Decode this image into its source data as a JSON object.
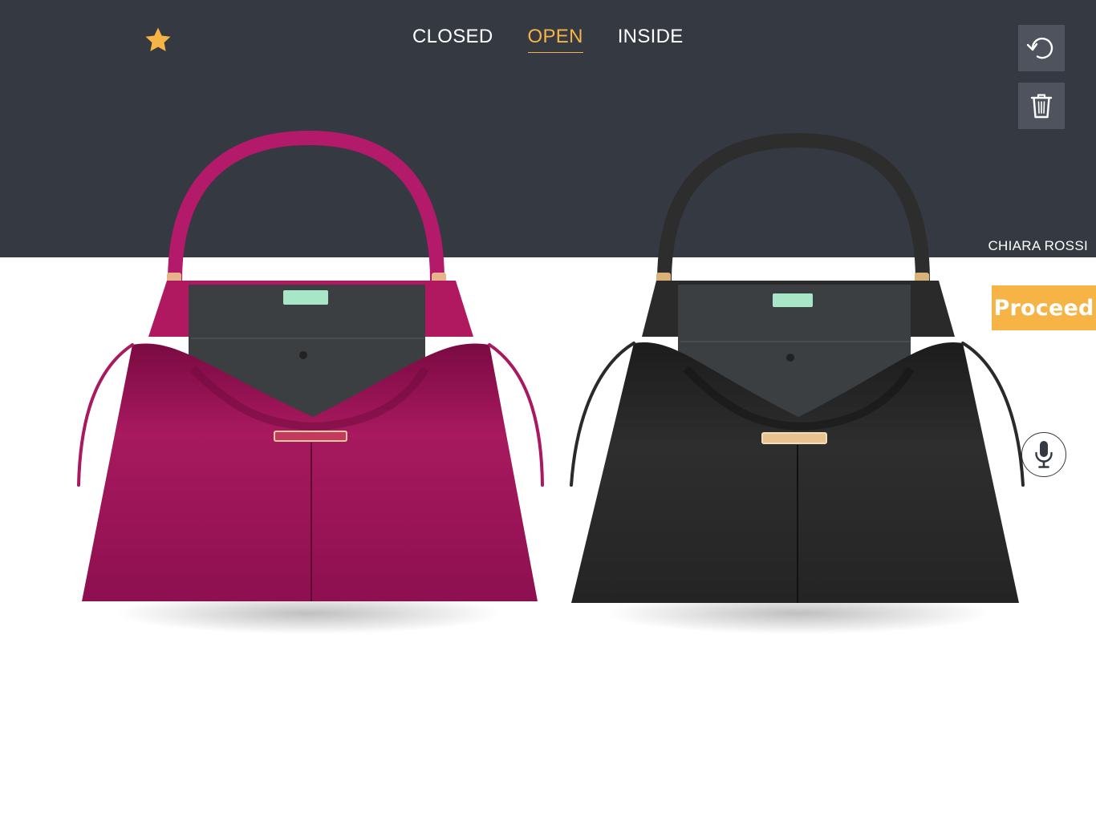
{
  "header": {
    "favorite_icon": "star-icon",
    "tabs": [
      {
        "label": "CLOSED",
        "active": false
      },
      {
        "label": "OPEN",
        "active": true
      },
      {
        "label": "INSIDE",
        "active": false
      }
    ],
    "undo_icon": "undo-icon",
    "delete_icon": "trash-icon",
    "user_name": "CHIARA ROSSI"
  },
  "actions": {
    "proceed_label": "Proceed",
    "mic_icon": "microphone-icon"
  },
  "products": [
    {
      "name": "bag-magenta",
      "color": "#9c1456"
    },
    {
      "name": "bag-black",
      "color": "#272727"
    }
  ],
  "colors": {
    "header_bg": "#343942",
    "accent": "#f6b447",
    "tool_bg": "#4e535d"
  }
}
